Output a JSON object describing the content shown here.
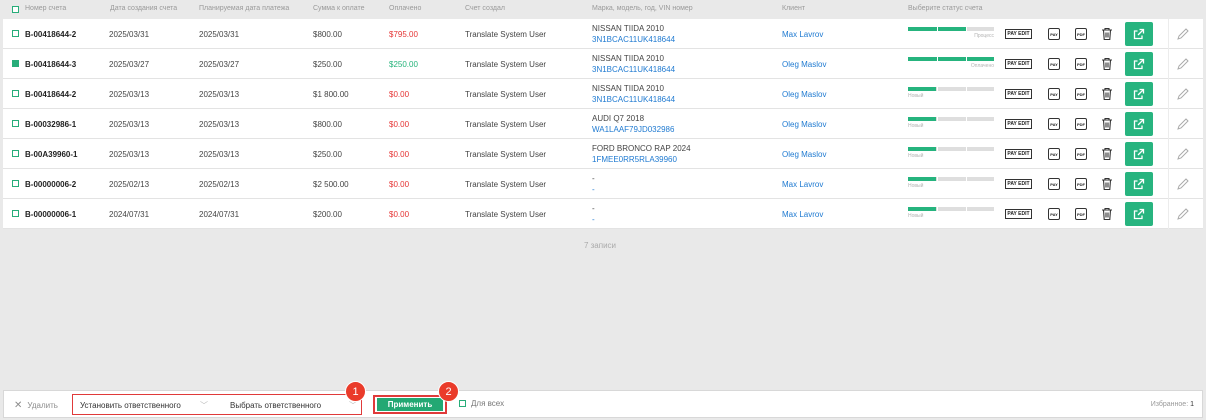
{
  "header": {
    "num": "Номер счета",
    "created": "Дата создания счета",
    "planned": "Планируемая дата платежа",
    "sum": "Сумма к оплате",
    "paid": "Оплачено",
    "creator": "Счет создал",
    "car": "Марка, модель, год, VIN номер",
    "client": "Клиент",
    "status": "Выберите статус счета"
  },
  "rows": [
    {
      "num": "B-00418644-2",
      "created": "2025/03/31",
      "planned": "2025/03/31",
      "sum": "$800.00",
      "paid": "$795.00",
      "paid_color": "#e53535",
      "creator": "Translate System User",
      "car": "NISSAN TIIDA 2010",
      "vin": "3N1BCAC11UK418644",
      "client": "Max Lavrov",
      "status_label": "Процесс",
      "status_level": 0.67,
      "checked": false
    },
    {
      "num": "B-00418644-3",
      "created": "2025/03/27",
      "planned": "2025/03/27",
      "sum": "$250.00",
      "paid": "$250.00",
      "paid_color": "#25b37a",
      "creator": "Translate System User",
      "car": "NISSAN TIIDA 2010",
      "vin": "3N1BCAC11UK418644",
      "client": "Oleg Maslov",
      "status_label": "Оплачено",
      "status_level": 1.0,
      "checked": true
    },
    {
      "num": "B-00418644-2",
      "created": "2025/03/13",
      "planned": "2025/03/13",
      "sum": "$1 800.00",
      "paid": "$0.00",
      "paid_color": "#e53535",
      "creator": "Translate System User",
      "car": "NISSAN TIIDA 2010",
      "vin": "3N1BCAC11UK418644",
      "client": "Oleg Maslov",
      "status_label": "Новый",
      "status_level": 0.33,
      "checked": false
    },
    {
      "num": "B-00032986-1",
      "created": "2025/03/13",
      "planned": "2025/03/13",
      "sum": "$800.00",
      "paid": "$0.00",
      "paid_color": "#e53535",
      "creator": "Translate System User",
      "car": "AUDI Q7 2018",
      "vin": "WA1LAAF79JD032986",
      "client": "Oleg Maslov",
      "status_label": "Новый",
      "status_level": 0.33,
      "checked": false
    },
    {
      "num": "B-00A39960-1",
      "created": "2025/03/13",
      "planned": "2025/03/13",
      "sum": "$250.00",
      "paid": "$0.00",
      "paid_color": "#e53535",
      "creator": "Translate System User",
      "car": "FORD BRONCO RAP 2024",
      "vin": "1FMEE0RR5RLA39960",
      "client": "Oleg Maslov",
      "status_label": "Новый",
      "status_level": 0.33,
      "checked": false
    },
    {
      "num": "B-00000006-2",
      "created": "2025/02/13",
      "planned": "2025/02/13",
      "sum": "$2 500.00",
      "paid": "$0.00",
      "paid_color": "#e53535",
      "creator": "Translate System User",
      "car": "-",
      "vin": "-",
      "client": "Max Lavrov",
      "status_label": "Новый",
      "status_level": 0.33,
      "checked": false
    },
    {
      "num": "B-00000006-1",
      "created": "2024/07/31",
      "planned": "2024/07/31",
      "sum": "$200.00",
      "paid": "$0.00",
      "paid_color": "#e53535",
      "creator": "Translate System User",
      "car": "-",
      "vin": "-",
      "client": "Max Lavrov",
      "status_label": "Новый",
      "status_level": 0.33,
      "checked": false
    }
  ],
  "actions": {
    "pay_edit": "PAY EDIT",
    "pay": "PAY",
    "pdf": "PDF"
  },
  "records_count": "7 записи",
  "bottom": {
    "delete": "Удалить",
    "set_responsible": "Установить ответственного",
    "choose_responsible": "Выбрать ответственного",
    "apply": "Применить",
    "for_all": "Для всех",
    "favorites_label": "Избранное:",
    "favorites_count": "1"
  },
  "badges": [
    "1",
    "2"
  ],
  "colors": {
    "accent": "#27b47f",
    "danger": "#e53535",
    "link": "#1f7ad1",
    "highlight": "#e03a3a"
  }
}
